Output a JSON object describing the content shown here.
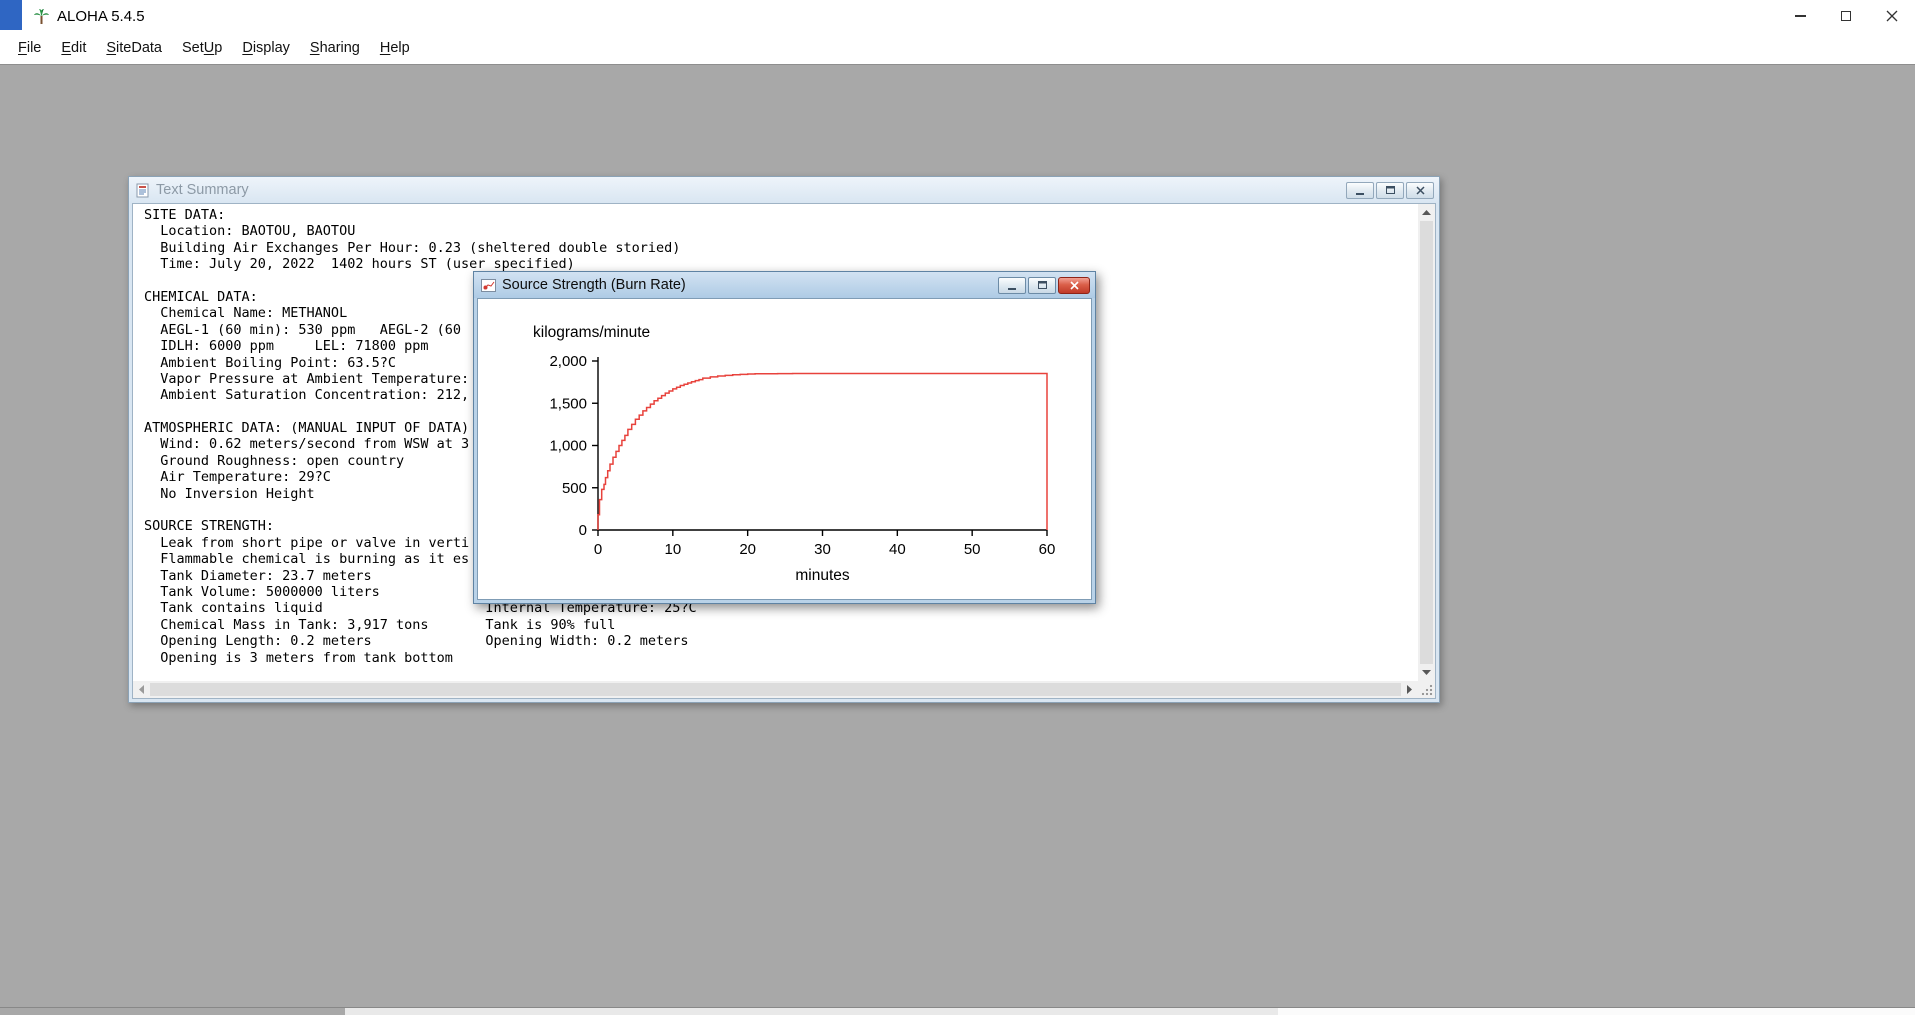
{
  "app": {
    "title": "ALOHA 5.4.5",
    "menu": [
      {
        "label": "File",
        "mnemonic": 0
      },
      {
        "label": "Edit",
        "mnemonic": 0
      },
      {
        "label": "SiteData",
        "mnemonic": 0
      },
      {
        "label": "SetUp",
        "mnemonic": 3
      },
      {
        "label": "Display",
        "mnemonic": 0
      },
      {
        "label": "Sharing",
        "mnemonic": 0
      },
      {
        "label": "Help",
        "mnemonic": 0
      }
    ]
  },
  "text_summary_window": {
    "title": "Text Summary",
    "lines": [
      "SITE DATA:",
      "  Location: BAOTOU, BAOTOU",
      "  Building Air Exchanges Per Hour: 0.23 (sheltered double storied)",
      "  Time: July 20, 2022  1402 hours ST (user specified)",
      "",
      "CHEMICAL DATA:",
      "  Chemical Name: METHANOL",
      "  AEGL-1 (60 min): 530 ppm   AEGL-2 (60",
      "  IDLH: 6000 ppm     LEL: 71800 ppm",
      "  Ambient Boiling Point: 63.5?C",
      "  Vapor Pressure at Ambient Temperature:",
      "  Ambient Saturation Concentration: 212,",
      "",
      "ATMOSPHERIC DATA: (MANUAL INPUT OF DATA)",
      "  Wind: 0.62 meters/second from WSW at 3",
      "  Ground Roughness: open country",
      "  Air Temperature: 29?C",
      "  No Inversion Height",
      "",
      "SOURCE STRENGTH:",
      "  Leak from short pipe or valve in verti",
      "  Flammable chemical is burning as it es",
      "  Tank Diameter: 23.7 meters",
      "  Tank Volume: 5000000 liters",
      "  Tank contains liquid                    Internal Temperature: 25?C",
      "  Chemical Mass in Tank: 3,917 tons       Tank is 90% full",
      "  Opening Length: 0.2 meters              Opening Width: 0.2 meters",
      "  Opening is 3 meters from tank bottom"
    ]
  },
  "burn_rate_window": {
    "title": "Source Strength (Burn Rate)"
  },
  "chart_data": {
    "type": "line",
    "title": "Source Strength (Burn Rate)",
    "ylabel": "kilograms/minute",
    "xlabel": "minutes",
    "xlim": [
      0,
      60
    ],
    "ylim": [
      0,
      2000
    ],
    "xticks": [
      0,
      10,
      20,
      30,
      40,
      50,
      60
    ],
    "yticks": [
      0,
      500,
      1000,
      1500,
      2000
    ],
    "ytick_labels": [
      "0",
      "500",
      "1,000",
      "1,500",
      "2,000"
    ],
    "grid": false,
    "legend": false,
    "line_color": "#e8423c",
    "series": [
      {
        "name": "burn-rate",
        "points": [
          [
            0,
            0
          ],
          [
            0.2,
            180
          ],
          [
            0.5,
            360
          ],
          [
            0.8,
            480
          ],
          [
            1,
            540
          ],
          [
            1.3,
            620
          ],
          [
            1.6,
            700
          ],
          [
            2,
            780
          ],
          [
            2.4,
            860
          ],
          [
            2.8,
            930
          ],
          [
            3.2,
            1000
          ],
          [
            3.6,
            1060
          ],
          [
            4,
            1120
          ],
          [
            4.5,
            1190
          ],
          [
            5,
            1250
          ],
          [
            5.5,
            1310
          ],
          [
            6,
            1360
          ],
          [
            6.5,
            1410
          ],
          [
            7,
            1450
          ],
          [
            7.5,
            1490
          ],
          [
            8,
            1530
          ],
          [
            8.5,
            1560
          ],
          [
            9,
            1590
          ],
          [
            9.5,
            1620
          ],
          [
            10,
            1645
          ],
          [
            10.5,
            1670
          ],
          [
            11,
            1690
          ],
          [
            11.5,
            1710
          ],
          [
            12,
            1725
          ],
          [
            12.5,
            1740
          ],
          [
            13,
            1755
          ],
          [
            13.5,
            1768
          ],
          [
            14,
            1780
          ],
          [
            15,
            1798
          ],
          [
            16,
            1812
          ],
          [
            17,
            1822
          ],
          [
            18,
            1830
          ],
          [
            19,
            1837
          ],
          [
            20,
            1842
          ],
          [
            21,
            1846
          ],
          [
            22,
            1848
          ],
          [
            24,
            1850
          ],
          [
            26,
            1851
          ],
          [
            30,
            1852
          ],
          [
            40,
            1852
          ],
          [
            50,
            1852
          ],
          [
            60,
            1852
          ],
          [
            60,
            0
          ]
        ]
      }
    ]
  }
}
